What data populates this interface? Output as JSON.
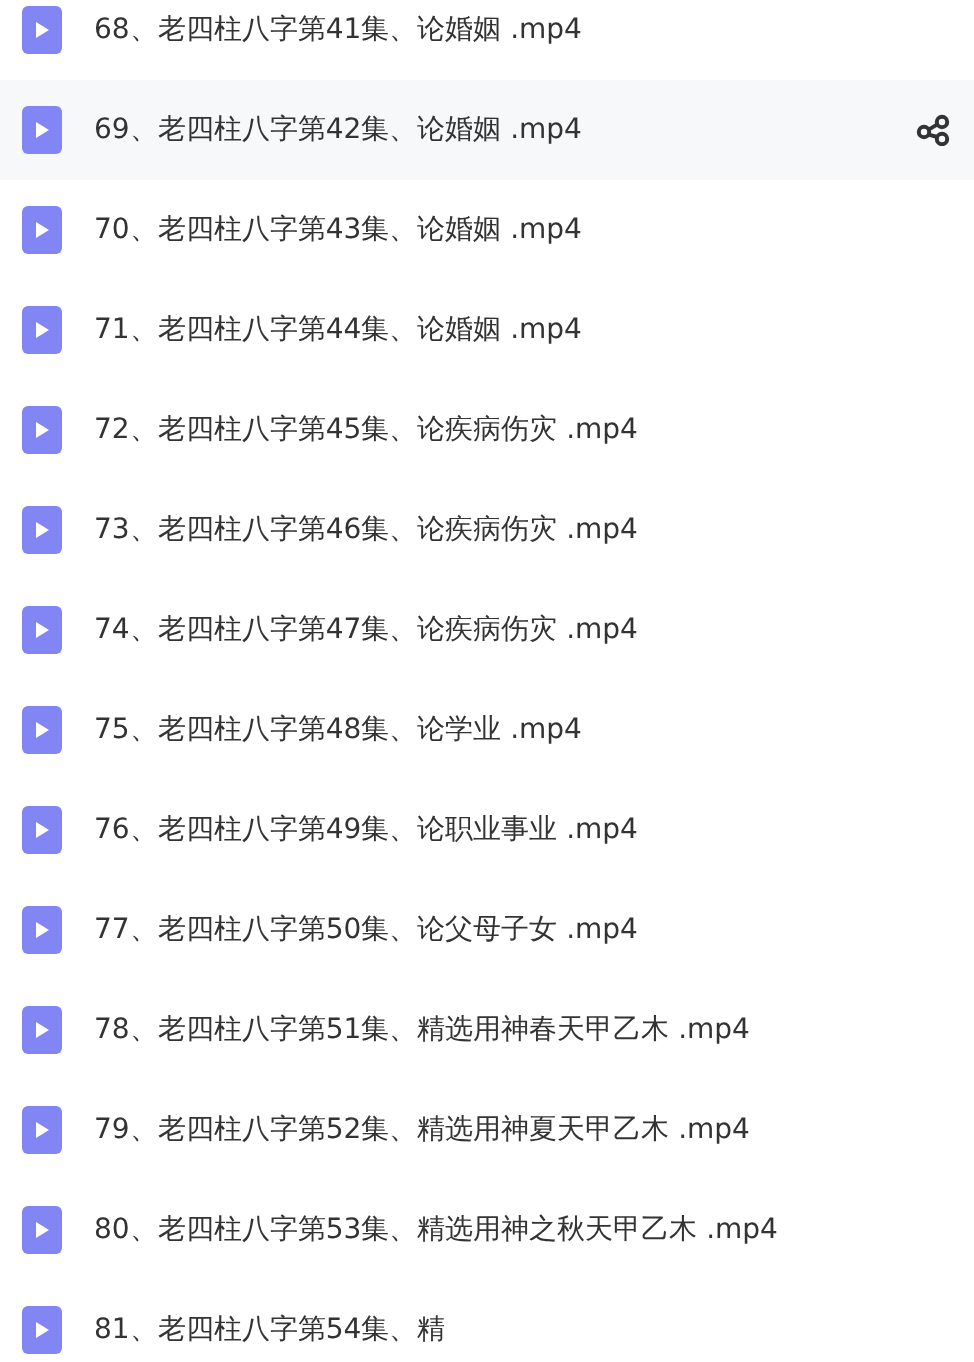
{
  "files": [
    {
      "name": "68、老四柱八字第41集、论婚姻 .mp4",
      "hovered": false
    },
    {
      "name": "69、老四柱八字第42集、论婚姻 .mp4",
      "hovered": true
    },
    {
      "name": "70、老四柱八字第43集、论婚姻 .mp4",
      "hovered": false
    },
    {
      "name": "71、老四柱八字第44集、论婚姻 .mp4",
      "hovered": false
    },
    {
      "name": "72、老四柱八字第45集、论疾病伤灾 .mp4",
      "hovered": false
    },
    {
      "name": "73、老四柱八字第46集、论疾病伤灾 .mp4",
      "hovered": false
    },
    {
      "name": "74、老四柱八字第47集、论疾病伤灾 .mp4",
      "hovered": false
    },
    {
      "name": "75、老四柱八字第48集、论学业 .mp4",
      "hovered": false
    },
    {
      "name": "76、老四柱八字第49集、论职业事业 .mp4",
      "hovered": false
    },
    {
      "name": "77、老四柱八字第50集、论父母子女 .mp4",
      "hovered": false
    },
    {
      "name": "78、老四柱八字第51集、精选用神春天甲乙木 .mp4",
      "hovered": false
    },
    {
      "name": "79、老四柱八字第52集、精选用神夏天甲乙木 .mp4",
      "hovered": false
    },
    {
      "name": "80、老四柱八字第53集、精选用神之秋天甲乙木 .mp4",
      "hovered": false
    },
    {
      "name": "81、老四柱八字第54集、精",
      "hovered": false
    }
  ]
}
